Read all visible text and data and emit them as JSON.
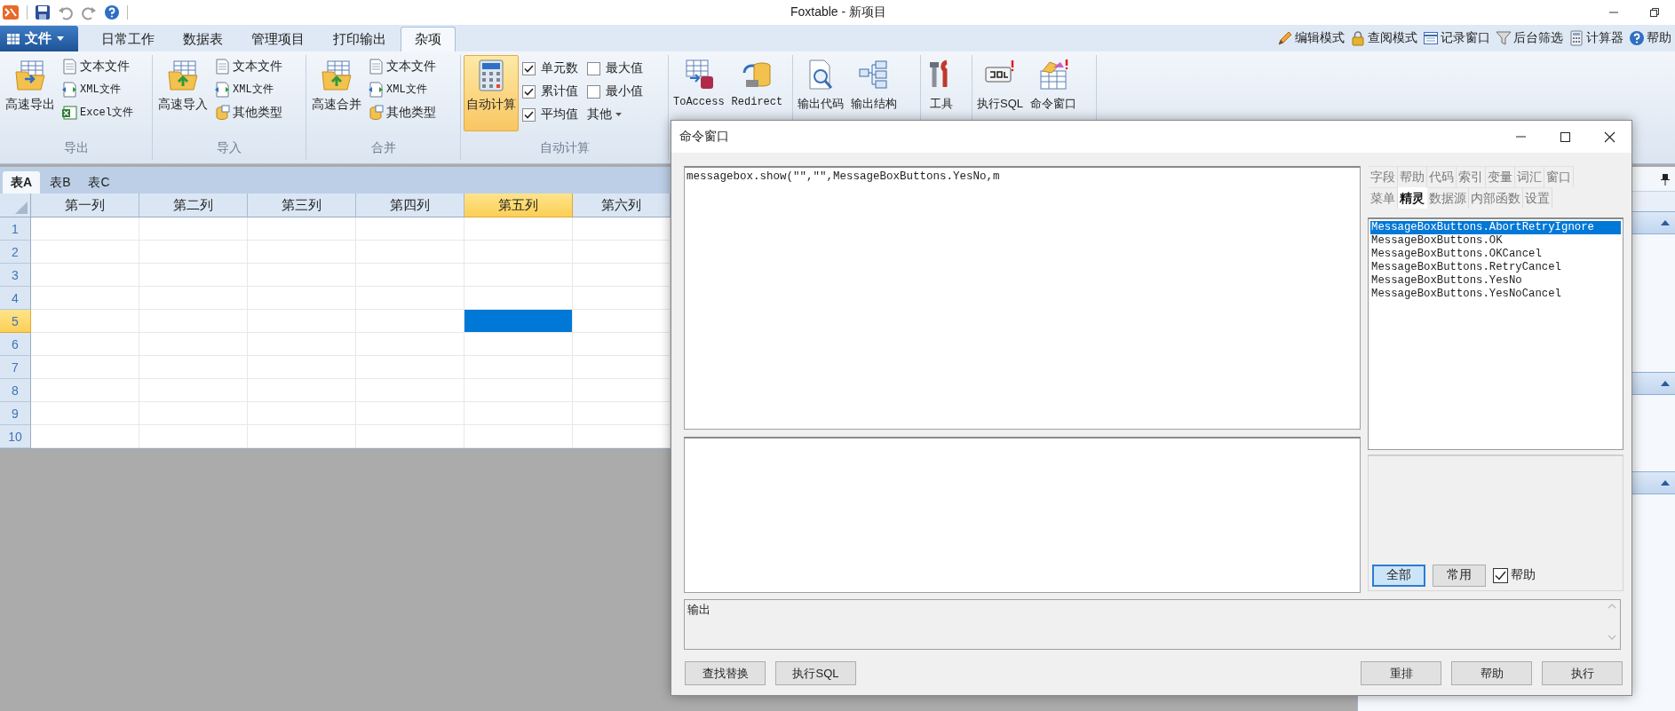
{
  "window": {
    "title": "Foxtable - 新项目"
  },
  "ribbon": {
    "file_menu": "文件",
    "tabs": [
      {
        "label": "日常工作",
        "selected": false
      },
      {
        "label": "数据表",
        "selected": false
      },
      {
        "label": "管理项目",
        "selected": false
      },
      {
        "label": "打印输出",
        "selected": false
      },
      {
        "label": "杂项",
        "selected": true
      }
    ],
    "tools": [
      "编辑模式",
      "查阅模式",
      "记录窗口",
      "后台筛选",
      "计算器",
      "帮助"
    ],
    "groups": [
      {
        "kind": "files",
        "label": "导出",
        "large": {
          "label": "高速导出",
          "on": false
        },
        "small": [
          "文本文件",
          "XML文件",
          "Excel文件"
        ]
      },
      {
        "kind": "files",
        "label": "导入",
        "large": {
          "label": "高速导入",
          "on": false
        },
        "small": [
          "文本文件",
          "XML文件",
          "其他类型"
        ]
      },
      {
        "kind": "files",
        "label": "合并",
        "large": {
          "label": "高速合并",
          "on": false
        },
        "small": [
          "文本文件",
          "XML文件",
          "其他类型"
        ]
      },
      {
        "kind": "calc",
        "label": "自动计算",
        "large": {
          "label": "自动计算",
          "on": true
        },
        "checks": [
          {
            "label": "单元数",
            "checked": true
          },
          {
            "label": "累计值",
            "checked": true
          },
          {
            "label": "平均值",
            "checked": true
          },
          {
            "label": "最大值",
            "checked": false
          },
          {
            "label": "最小值",
            "checked": false
          }
        ],
        "menu": "其他"
      },
      {
        "kind": "buttons",
        "buttons": [
          "ToAccess",
          "Redirect"
        ]
      },
      {
        "kind": "buttons",
        "buttons": [
          "输出代码",
          "输出结构"
        ]
      },
      {
        "kind": "buttons",
        "buttons": [
          "工具"
        ]
      },
      {
        "kind": "buttons",
        "buttons": [
          "执行SQL",
          "命令窗口"
        ]
      }
    ]
  },
  "sheet": {
    "tabs": [
      {
        "label": "表A",
        "selected": true
      },
      {
        "label": "表B",
        "selected": false
      },
      {
        "label": "表C",
        "selected": false
      }
    ],
    "columns": [
      {
        "label": "第一列",
        "selected": false
      },
      {
        "label": "第二列",
        "selected": false
      },
      {
        "label": "第三列",
        "selected": false
      },
      {
        "label": "第四列",
        "selected": false
      },
      {
        "label": "第五列",
        "selected": true
      },
      {
        "label": "第六列",
        "selected": false
      }
    ],
    "rows": [
      {
        "label": "1",
        "selected": false
      },
      {
        "label": "2",
        "selected": false
      },
      {
        "label": "3",
        "selected": false
      },
      {
        "label": "4",
        "selected": false
      },
      {
        "label": "5",
        "selected": true
      },
      {
        "label": "6",
        "selected": false
      },
      {
        "label": "7",
        "selected": false
      },
      {
        "label": "8",
        "selected": false
      },
      {
        "label": "9",
        "selected": false
      },
      {
        "label": "10",
        "selected": false
      }
    ]
  },
  "dialog": {
    "title": "命令窗口",
    "code": "messagebox.show(\"\",\"\",MessageBoxButtons.YesNo,m",
    "tab_rows": [
      {
        "tabs": [
          {
            "label": "字段",
            "selected": false
          },
          {
            "label": "帮助",
            "selected": false
          },
          {
            "label": "代码",
            "selected": false
          },
          {
            "label": "索引",
            "selected": false
          },
          {
            "label": "变量",
            "selected": false
          },
          {
            "label": "词汇",
            "selected": false
          },
          {
            "label": "窗口",
            "selected": false
          }
        ]
      },
      {
        "tabs": [
          {
            "label": "菜单",
            "selected": false
          },
          {
            "label": "精灵",
            "selected": true
          },
          {
            "label": "数据源",
            "selected": false
          },
          {
            "label": "内部函数",
            "selected": false
          },
          {
            "label": "设置",
            "selected": false
          }
        ]
      }
    ],
    "list": [
      {
        "text": "MessageBoxButtons.AbortRetryIgnore",
        "selected": true
      },
      {
        "text": "MessageBoxButtons.OK",
        "selected": false
      },
      {
        "text": "MessageBoxButtons.OKCancel",
        "selected": false
      },
      {
        "text": "MessageBoxButtons.RetryCancel",
        "selected": false
      },
      {
        "text": "MessageBoxButtons.YesNo",
        "selected": false
      },
      {
        "text": "MessageBoxButtons.YesNoCancel",
        "selected": false
      }
    ],
    "filters": [
      {
        "label": "全部",
        "selected": true
      },
      {
        "label": "常用",
        "selected": false
      }
    ],
    "help_checkbox": {
      "label": "帮助",
      "checked": true
    },
    "output": "输出",
    "left_buttons": [
      "查找替换",
      "执行SQL"
    ],
    "right_buttons": [
      "重排",
      "帮助",
      "执行"
    ]
  }
}
